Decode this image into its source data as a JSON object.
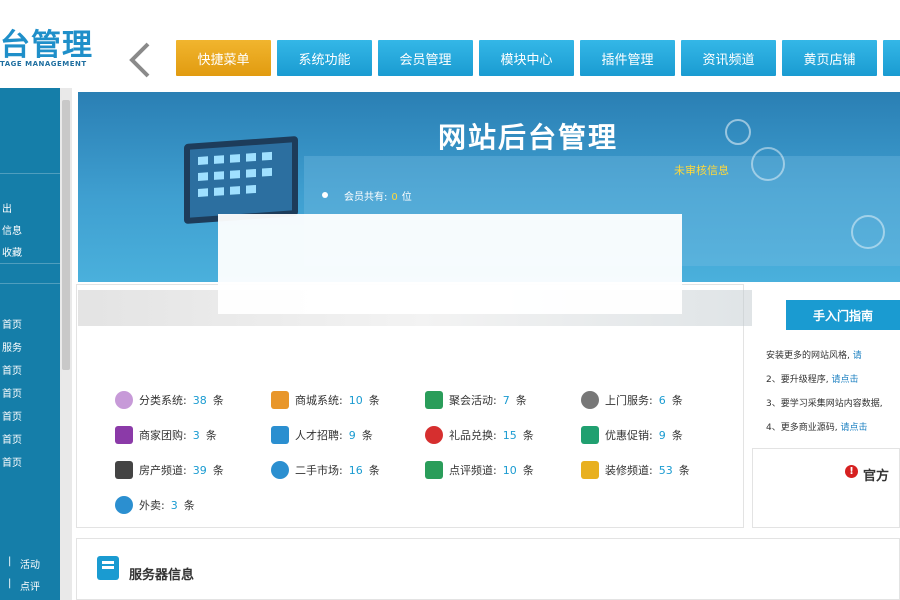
{
  "logo": {
    "main": "台管理",
    "sub": "TAGE MANAGEMENT"
  },
  "nav": {
    "tabs": [
      {
        "label": "快捷菜单",
        "active": true
      },
      {
        "label": "系统功能",
        "active": false
      },
      {
        "label": "会员管理",
        "active": false
      },
      {
        "label": "模块中心",
        "active": false
      },
      {
        "label": "插件管理",
        "active": false
      },
      {
        "label": "资讯频道",
        "active": false
      },
      {
        "label": "黄页店铺",
        "active": false
      }
    ]
  },
  "sidebar": {
    "items": [
      "出",
      "信息",
      "收藏",
      "首页",
      "服务",
      "首页",
      "首页",
      "首页",
      "首页",
      "首页"
    ],
    "bottom": [
      {
        "left": "|",
        "right": "活动"
      },
      {
        "left": "|",
        "right": "点评"
      }
    ]
  },
  "banner": {
    "title": "网站后台管理",
    "unread": "未审核信息",
    "member_label": "会员共有:",
    "member_count": "0",
    "member_unit": "位"
  },
  "stats": [
    {
      "label": "分类系统:",
      "count": "38",
      "unit": "条",
      "icon": "flower-icon",
      "color": "#c79ad8"
    },
    {
      "label": "商城系统:",
      "count": "10",
      "unit": "条",
      "icon": "shop-icon",
      "color": "#e8962a"
    },
    {
      "label": "聚会活动:",
      "count": "7",
      "unit": "条",
      "icon": "people-icon",
      "color": "#2a9d5a"
    },
    {
      "label": "上门服务:",
      "count": "6",
      "unit": "条",
      "icon": "clipboard-icon",
      "color": "#777777"
    },
    {
      "label": "商家团购:",
      "count": "3",
      "unit": "条",
      "icon": "group-buy-icon",
      "color": "#8b3aa8"
    },
    {
      "label": "人才招聘:",
      "count": "9",
      "unit": "条",
      "icon": "person-icon",
      "color": "#2b8fd0"
    },
    {
      "label": "礼品兑换:",
      "count": "15",
      "unit": "条",
      "icon": "gift-icon",
      "color": "#d62f2f"
    },
    {
      "label": "优惠促销:",
      "count": "9",
      "unit": "条",
      "icon": "promo-icon",
      "color": "#20a070"
    },
    {
      "label": "房产频道:",
      "count": "39",
      "unit": "条",
      "icon": "building-icon",
      "color": "#444444"
    },
    {
      "label": "二手市场:",
      "count": "16",
      "unit": "条",
      "icon": "recycle-icon",
      "color": "#2b8fd0"
    },
    {
      "label": "点评频道:",
      "count": "10",
      "unit": "条",
      "icon": "cup-icon",
      "color": "#2a9d5a"
    },
    {
      "label": "装修频道:",
      "count": "53",
      "unit": "条",
      "icon": "paint-roller-icon",
      "color": "#e8b020"
    },
    {
      "label": "外卖:",
      "count": "3",
      "unit": "条",
      "icon": "refresh-icon",
      "color": "#2b8fd0"
    }
  ],
  "guide": {
    "tab": "手入门指南",
    "rows": [
      {
        "text": "安装更多的网站风格, ",
        "link": "请"
      },
      {
        "text": "2、要升级程序, ",
        "link": "请点击"
      },
      {
        "text": "3、要学习采集网站内容数据, ",
        "link": ""
      },
      {
        "text": "4、更多商业源码, ",
        "link": "请点击"
      }
    ]
  },
  "official": {
    "text": "官方"
  },
  "server": {
    "title": "服务器信息"
  }
}
